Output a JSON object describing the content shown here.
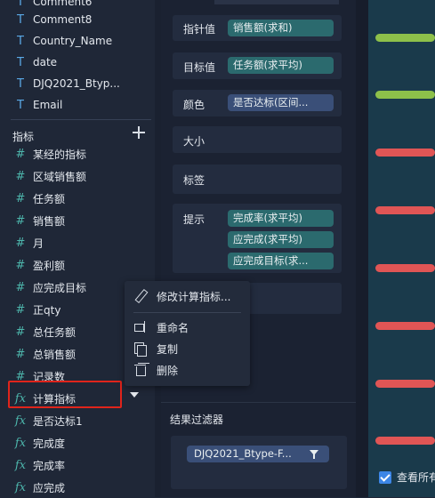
{
  "dimensions": {
    "items": [
      {
        "label": "Comment6",
        "icon": "text-type-icon"
      },
      {
        "label": "Comment8",
        "icon": "text-type-icon"
      },
      {
        "label": "Country_Name",
        "icon": "text-type-icon"
      },
      {
        "label": "date",
        "icon": "text-type-icon"
      },
      {
        "label": "DJQ2021_Btyp...",
        "icon": "text-type-icon"
      },
      {
        "label": "Email",
        "icon": "text-type-icon"
      }
    ]
  },
  "metrics": {
    "header": "指标",
    "items": [
      {
        "label": "某经的指标",
        "kind": "number"
      },
      {
        "label": "区域销售额",
        "kind": "number"
      },
      {
        "label": "任务额",
        "kind": "number"
      },
      {
        "label": "销售额",
        "kind": "number"
      },
      {
        "label": "月",
        "kind": "number"
      },
      {
        "label": "盈利额",
        "kind": "number"
      },
      {
        "label": "应完成目标",
        "kind": "number"
      },
      {
        "label": "正qty",
        "kind": "number"
      },
      {
        "label": "总任务额",
        "kind": "number"
      },
      {
        "label": "总销售额",
        "kind": "number"
      },
      {
        "label": "记录数",
        "kind": "number"
      },
      {
        "label": "计算指标",
        "kind": "calc"
      },
      {
        "label": "是否达标1",
        "kind": "calc"
      },
      {
        "label": "完成度",
        "kind": "calc"
      },
      {
        "label": "完成率",
        "kind": "calc"
      },
      {
        "label": "应完成",
        "kind": "calc"
      }
    ]
  },
  "icons": {
    "number": "#",
    "text": "T",
    "calc": "fx"
  },
  "config": {
    "pointer": {
      "label": "指针值",
      "chip": "销售额(求和)"
    },
    "target": {
      "label": "目标值",
      "chip": "任务额(求平均)"
    },
    "color": {
      "label": "颜色",
      "chip": "是否达标(区间..."
    },
    "size": {
      "label": "大小"
    },
    "tag": {
      "label": "标签"
    },
    "tooltip": {
      "label": "提示",
      "chips": [
        "完成率(求平均)",
        "应完成(求平均)",
        "应完成目标(求..."
      ]
    }
  },
  "result_filter": {
    "title": "结果过滤器",
    "chip": "DJQ2021_Btype-F..."
  },
  "context_menu": {
    "items": [
      {
        "label": "修改计算指标...",
        "icon": "edit-icon"
      },
      {
        "label": "重命名",
        "icon": "rename-icon"
      },
      {
        "label": "复制",
        "icon": "copy-icon"
      },
      {
        "label": "删除",
        "icon": "delete-icon"
      }
    ]
  },
  "chart": {
    "bar_colors": [
      "#8dc04a",
      "#8dc04a",
      "#e05555",
      "#e05555",
      "#e05555",
      "#e05555",
      "#e05555",
      "#e05555",
      "#e05555"
    ]
  },
  "footer": {
    "show_all_label": "查看所有",
    "show_all_checked": true
  }
}
